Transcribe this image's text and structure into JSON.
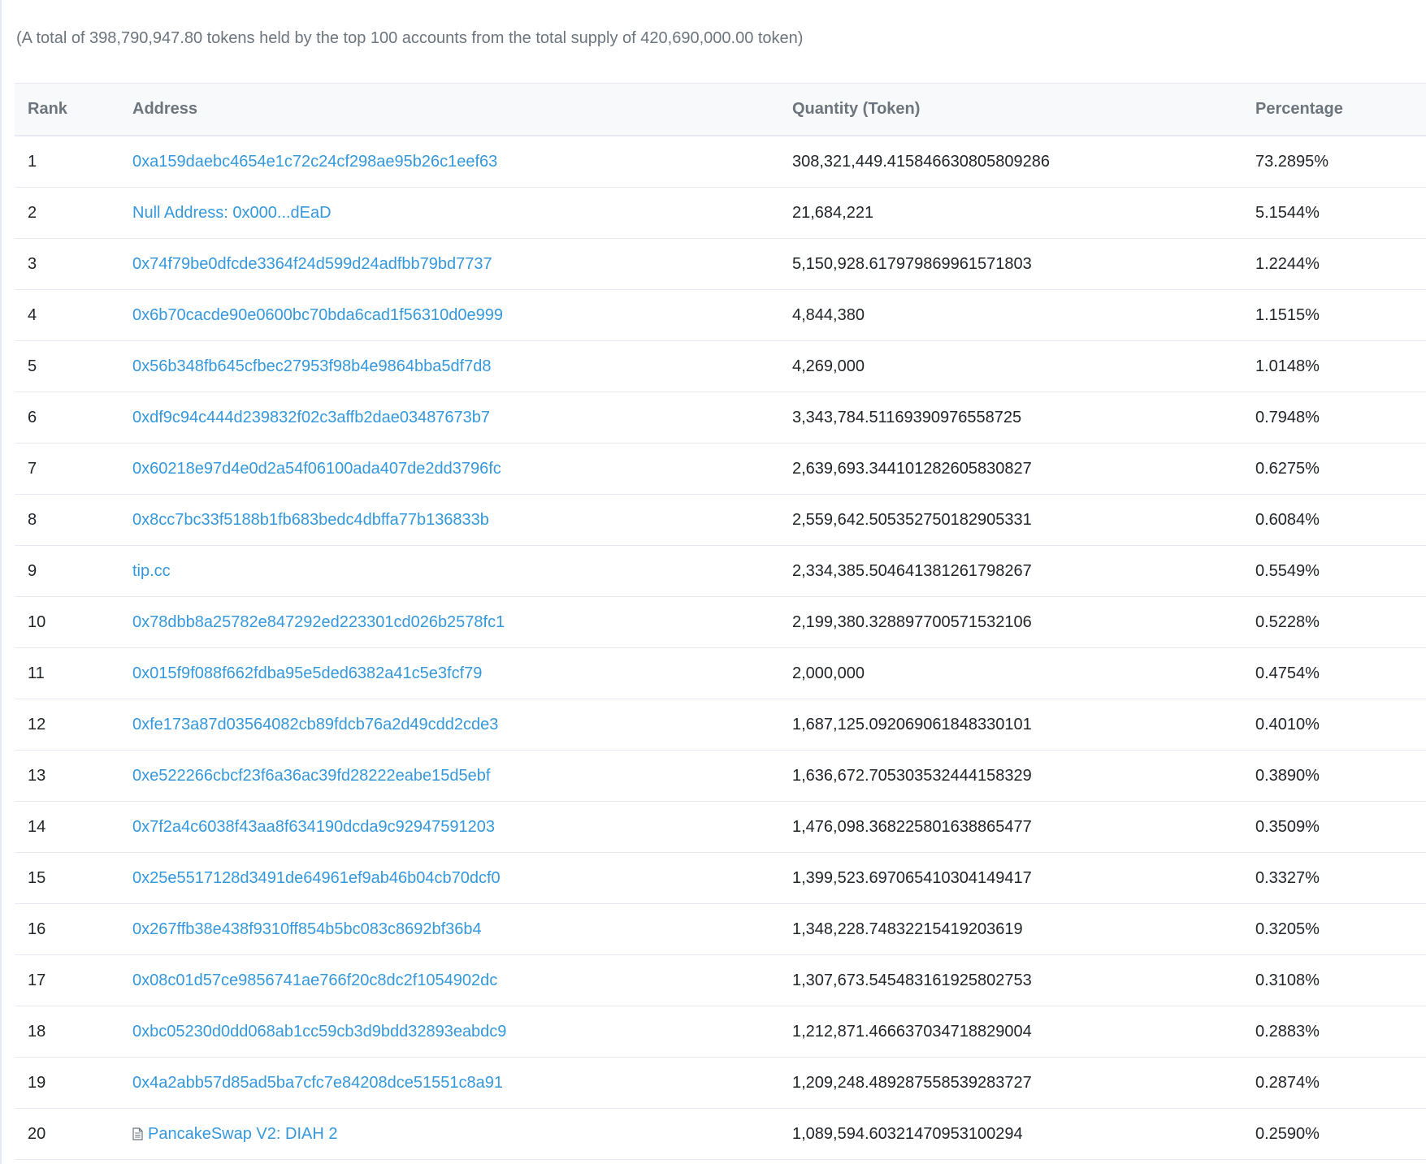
{
  "summary": "(A total of 398,790,947.80 tokens held by the top 100 accounts from the total supply of 420,690,000.00 token)",
  "table": {
    "headers": {
      "rank": "Rank",
      "address": "Address",
      "quantity": "Quantity (Token)",
      "percentage": "Percentage"
    },
    "rows": [
      {
        "rank": "1",
        "address": "0xa159daebc4654e1c72c24cf298ae95b26c1eef63",
        "quantity": "308,321,449.415846630805809286",
        "percentage": "73.2895%",
        "contract": false
      },
      {
        "rank": "2",
        "address": "Null Address: 0x000...dEaD",
        "quantity": "21,684,221",
        "percentage": "5.1544%",
        "contract": false
      },
      {
        "rank": "3",
        "address": "0x74f79be0dfcde3364f24d599d24adfbb79bd7737",
        "quantity": "5,150,928.617979869961571803",
        "percentage": "1.2244%",
        "contract": false
      },
      {
        "rank": "4",
        "address": "0x6b70cacde90e0600bc70bda6cad1f56310d0e999",
        "quantity": "4,844,380",
        "percentage": "1.1515%",
        "contract": false
      },
      {
        "rank": "5",
        "address": "0x56b348fb645cfbec27953f98b4e9864bba5df7d8",
        "quantity": "4,269,000",
        "percentage": "1.0148%",
        "contract": false
      },
      {
        "rank": "6",
        "address": "0xdf9c94c444d239832f02c3affb2dae03487673b7",
        "quantity": "3,343,784.51169390976558725",
        "percentage": "0.7948%",
        "contract": false
      },
      {
        "rank": "7",
        "address": "0x60218e97d4e0d2a54f06100ada407de2dd3796fc",
        "quantity": "2,639,693.344101282605830827",
        "percentage": "0.6275%",
        "contract": false
      },
      {
        "rank": "8",
        "address": "0x8cc7bc33f5188b1fb683bedc4dbffa77b136833b",
        "quantity": "2,559,642.505352750182905331",
        "percentage": "0.6084%",
        "contract": false
      },
      {
        "rank": "9",
        "address": "tip.cc",
        "quantity": "2,334,385.504641381261798267",
        "percentage": "0.5549%",
        "contract": false
      },
      {
        "rank": "10",
        "address": "0x78dbb8a25782e847292ed223301cd026b2578fc1",
        "quantity": "2,199,380.328897700571532106",
        "percentage": "0.5228%",
        "contract": false
      },
      {
        "rank": "11",
        "address": "0x015f9f088f662fdba95e5ded6382a41c5e3fcf79",
        "quantity": "2,000,000",
        "percentage": "0.4754%",
        "contract": false
      },
      {
        "rank": "12",
        "address": "0xfe173a87d03564082cb89fdcb76a2d49cdd2cde3",
        "quantity": "1,687,125.092069061848330101",
        "percentage": "0.4010%",
        "contract": false
      },
      {
        "rank": "13",
        "address": "0xe522266cbcf23f6a36ac39fd28222eabe15d5ebf",
        "quantity": "1,636,672.705303532444158329",
        "percentage": "0.3890%",
        "contract": false
      },
      {
        "rank": "14",
        "address": "0x7f2a4c6038f43aa8f634190dcda9c92947591203",
        "quantity": "1,476,098.368225801638865477",
        "percentage": "0.3509%",
        "contract": false
      },
      {
        "rank": "15",
        "address": "0x25e5517128d3491de64961ef9ab46b04cb70dcf0",
        "quantity": "1,399,523.697065410304149417",
        "percentage": "0.3327%",
        "contract": false
      },
      {
        "rank": "16",
        "address": "0x267ffb38e438f9310ff854b5bc083c8692bf36b4",
        "quantity": "1,348,228.74832215419203619",
        "percentage": "0.3205%",
        "contract": false
      },
      {
        "rank": "17",
        "address": "0x08c01d57ce9856741ae766f20c8dc2f1054902dc",
        "quantity": "1,307,673.545483161925802753",
        "percentage": "0.3108%",
        "contract": false
      },
      {
        "rank": "18",
        "address": "0xbc05230d0dd068ab1cc59cb3d9bdd32893eabdc9",
        "quantity": "1,212,871.466637034718829004",
        "percentage": "0.2883%",
        "contract": false
      },
      {
        "rank": "19",
        "address": "0x4a2abb57d85ad5ba7cfc7e84208dce51551c8a91",
        "quantity": "1,209,248.489287558539283727",
        "percentage": "0.2874%",
        "contract": false
      },
      {
        "rank": "20",
        "address": "PancakeSwap V2: DIAH 2",
        "quantity": "1,089,594.60321470953100294",
        "percentage": "0.2590%",
        "contract": true
      }
    ]
  },
  "colors": {
    "link": "#3498db",
    "header_bg": "#f8f9fa",
    "border": "#e7eaf3",
    "muted_text": "#6c757d"
  },
  "icons": {
    "contract": "document-icon"
  }
}
